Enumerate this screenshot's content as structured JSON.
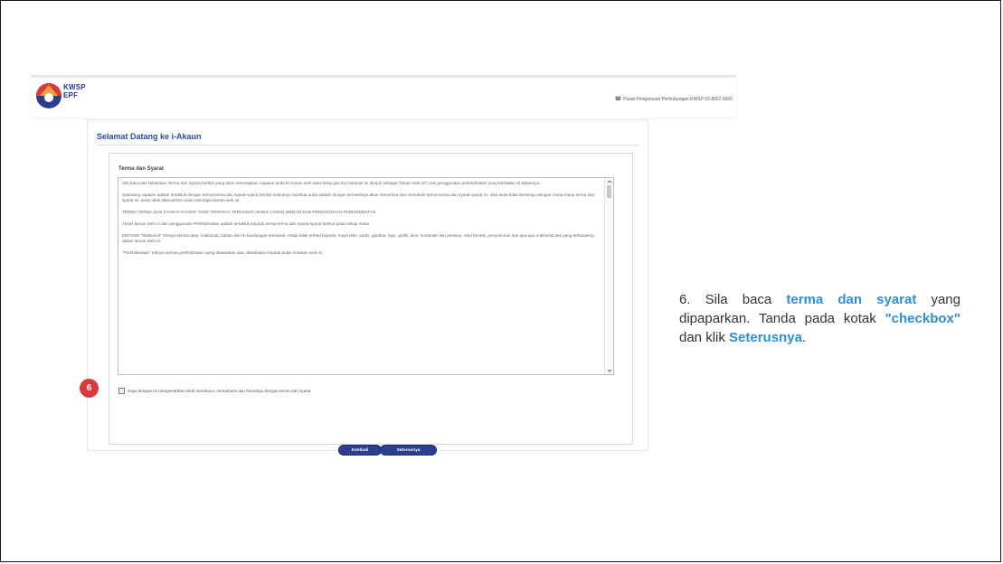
{
  "header": {
    "logo_line1": "KWSP",
    "logo_line2": "EPF",
    "contact_text": "Pusat Pengurusan Perhubungan KWSP 03-8922 6000",
    "brand_colors": {
      "primary": "#2b3f8f",
      "accent": "#d93a3a",
      "highlight": "#2e8fd6"
    }
  },
  "page": {
    "title": "Selamat Datang ke i-Akaun"
  },
  "terms": {
    "heading": "Terma dan Syarat",
    "paragraphs": [
      "Sila baca dan fahamkan Terma dan Syarat berikut yang akan menetapkan capaian anda ke laman web www.kwsp.gov.my (selepas ini dirujuk sebagai \"laman web ini\") dan penggunaan perkhidmatan yang berkaitan di dalamnya.",
      "Sebarang capaian adalah tertakluk dengan terma-terma dan syarat-syarat berikut sekiranya Syarikat anda adalah dengan semestinya akan menerima dan mematuhi terma-terma dan syarat-syarat ini. Jika anda tidak bersetuju dengan mana-mana terma dan syarat ini, anda tidak dibenarkan untuk mencapai laman web ini.",
      "TERMA-TERMA DAN SYARAT-SYARAT YANG TERPAKAI TERHADAP AKSES LAMAN WEB INI DAN PENGGUNAAN PERKHIDMATAN.",
      "Akses laman web ini dan penggunaan Perkhidmatan adalah tertakluk kepada terma-terma dan syarat-syarat berikut pada setiap masa.",
      "DEFINISI \"Maklumat\" ertinya semua data, maklumat, bahan dan isi kandungan termasuk, tetapi tidak terhad kepada, maya teks, audio, gambar, logo, grafik, ikon, komputer dan perisian, reka bentuk, penyusunan dan apa-apa maklumat lain yang terkandung dalam laman web ini.",
      "\"Perkhidmatan\" ertinya semua perkhidmatan yang ditawarkan atau disediakan kepada anda di laman web ini."
    ],
    "agree_label": "Saya dengan ini mengesahkan telah membaca, memahami dan bersetuju dengan terma dan syarat."
  },
  "buttons": {
    "back": "Kembali",
    "next": "Seterusnya"
  },
  "step_badge": "6",
  "instruction": {
    "prefix": "6. Sila baca ",
    "terms_link": "terma dan syarat",
    "middle1": " yang dipaparkan. Tanda pada kotak ",
    "checkbox_word": "\"checkbox\"",
    "middle2": " dan klik ",
    "next_word": "Seterusnya",
    "suffix": "."
  }
}
